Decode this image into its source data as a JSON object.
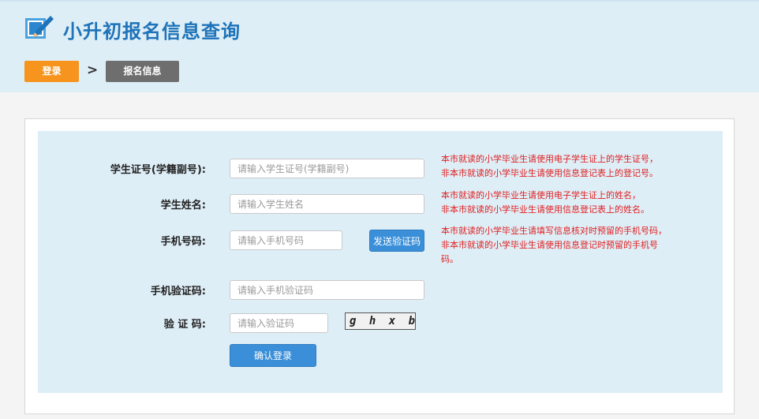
{
  "header": {
    "title": "小升初报名信息查询",
    "logo_icon": "book-pencil-icon"
  },
  "breadcrumb": {
    "step1": "登录",
    "separator": ">",
    "step2": "报名信息"
  },
  "form": {
    "student_id": {
      "label": "学生证号(学籍副号):",
      "placeholder": "请输入学生证号(学籍副号)",
      "value": "",
      "hint_line1": "本市就读的小学毕业生请使用电子学生证上的学生证号，",
      "hint_line2": "非本市就读的小学毕业生请使用信息登记表上的登记号。"
    },
    "student_name": {
      "label": "学生姓名:",
      "placeholder": "请输入学生姓名",
      "value": "",
      "hint_line1": "本市就读的小学毕业生请使用电子学生证上的姓名，",
      "hint_line2": "非本市就读的小学毕业生请使用信息登记表上的姓名。"
    },
    "phone": {
      "label": "手机号码:",
      "placeholder": "请输入手机号码",
      "value": "",
      "send_button": "发送验证码",
      "hint_line1": "本市就读的小学毕业生请填写信息核对时预留的手机号码，",
      "hint_line2": "非本市就读的小学毕业生请使用信息登记时预留的手机号",
      "hint_line3": "码。"
    },
    "sms_code": {
      "label": "手机验证码:",
      "placeholder": "请输入手机验证码",
      "value": ""
    },
    "captcha": {
      "label": "验 证 码:",
      "placeholder": "请输入验证码",
      "value": "",
      "image_text": "g h x b"
    },
    "submit_button": "确认登录"
  },
  "colors": {
    "brand_blue": "#1e73b9",
    "button_blue": "#3a8fd8",
    "orange": "#f7941d",
    "panel_bg": "#deeef7",
    "hint_red": "#e02020"
  }
}
